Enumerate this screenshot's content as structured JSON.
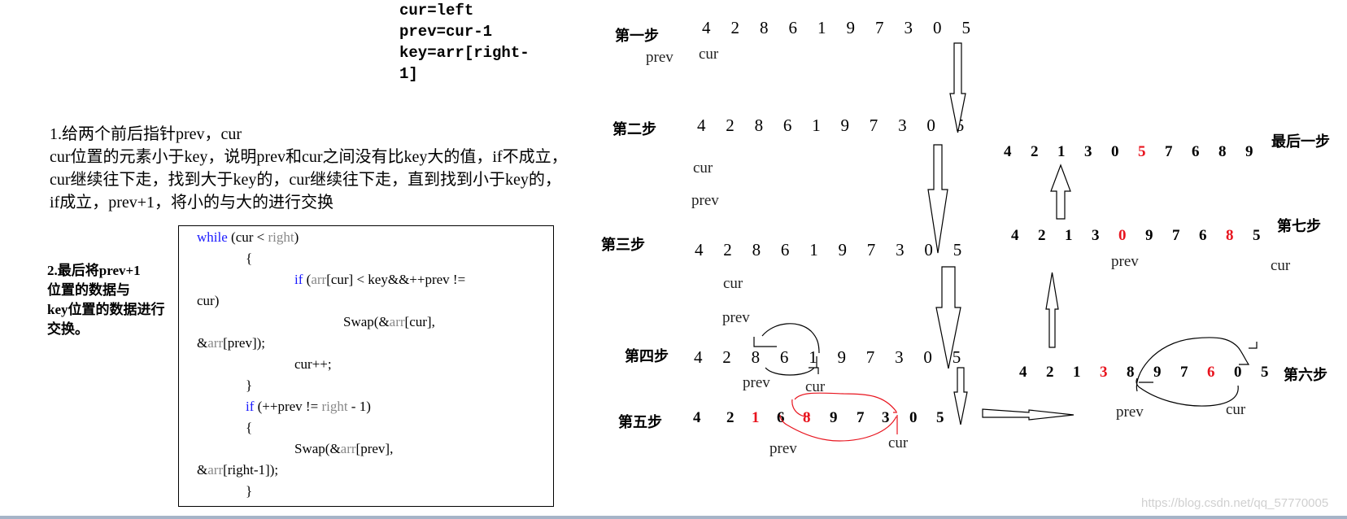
{
  "init_vars": [
    "cur=left",
    "prev=cur-1",
    "key=arr[right-",
    "1]"
  ],
  "explanation": {
    "line1": "1.给两个前后指针prev，cur",
    "body": "cur位置的元素小于key，说明prev和cur之间没有比key大的值，if不成立，cur继续往下走，找到大于key的，cur继续往下走，直到找到小于key的，if成立，prev+1，将小的与大的进行交换"
  },
  "note2": [
    "2.最后将prev+1",
    "位置的数据与",
    "key位置的数据进行",
    "交换。"
  ],
  "code": {
    "lines": [
      {
        "indent": 0,
        "parts": [
          {
            "t": "while",
            "c": "kw"
          },
          {
            "t": " (cur < "
          },
          {
            "t": "right",
            "c": "gr"
          },
          {
            "t": ")"
          }
        ]
      },
      {
        "indent": 1,
        "parts": [
          {
            "t": "{"
          }
        ]
      },
      {
        "indent": 2,
        "parts": [
          {
            "t": "if",
            "c": "kw"
          },
          {
            "t": " ("
          },
          {
            "t": "arr",
            "c": "gr"
          },
          {
            "t": "[cur] < key&&++prev !="
          }
        ]
      },
      {
        "indent": 0,
        "parts": [
          {
            "t": "cur)"
          }
        ]
      },
      {
        "indent": 3,
        "parts": [
          {
            "t": "Swap(&"
          },
          {
            "t": "arr",
            "c": "gr"
          },
          {
            "t": "[cur],"
          }
        ]
      },
      {
        "indent": 0,
        "parts": [
          {
            "t": "&"
          },
          {
            "t": "arr",
            "c": "gr"
          },
          {
            "t": "[prev]);"
          }
        ]
      },
      {
        "indent": 2,
        "parts": [
          {
            "t": "cur++;"
          }
        ]
      },
      {
        "indent": 1,
        "parts": [
          {
            "t": "}"
          }
        ]
      },
      {
        "indent": 1,
        "parts": [
          {
            "t": "if",
            "c": "kw"
          },
          {
            "t": " (++prev != "
          },
          {
            "t": "right",
            "c": "gr"
          },
          {
            "t": " - 1)"
          }
        ]
      },
      {
        "indent": 1,
        "parts": [
          {
            "t": "{"
          }
        ]
      },
      {
        "indent": 2,
        "parts": [
          {
            "t": "Swap(&"
          },
          {
            "t": "arr",
            "c": "gr"
          },
          {
            "t": "[prev],"
          }
        ]
      },
      {
        "indent": 0,
        "parts": [
          {
            "t": "&"
          },
          {
            "t": "arr",
            "c": "gr"
          },
          {
            "t": "[right-1]);"
          }
        ]
      },
      {
        "indent": 1,
        "parts": [
          {
            "t": "}"
          }
        ]
      }
    ]
  },
  "steps": [
    {
      "id": "step1",
      "label": "第一步",
      "values": [
        4,
        2,
        8,
        6,
        1,
        9,
        7,
        3,
        0,
        5
      ],
      "red": [],
      "bold": false,
      "pointers": [
        {
          "name": "prev",
          "index": -1
        },
        {
          "name": "cur",
          "index": 0
        }
      ]
    },
    {
      "id": "step2",
      "label": "第二步",
      "values": [
        4,
        2,
        8,
        6,
        1,
        9,
        7,
        3,
        0,
        5
      ],
      "red": [],
      "bold": false,
      "pointers": [
        {
          "name": "cur",
          "index": 0
        },
        {
          "name": "prev",
          "index": 0
        }
      ]
    },
    {
      "id": "step3",
      "label": "第三步",
      "values": [
        4,
        2,
        8,
        6,
        1,
        9,
        7,
        3,
        0,
        5
      ],
      "red": [],
      "bold": false,
      "pointers": [
        {
          "name": "cur",
          "index": 1
        },
        {
          "name": "prev",
          "index": 1
        }
      ]
    },
    {
      "id": "step4",
      "label": "第四步",
      "values": [
        4,
        2,
        8,
        6,
        1,
        9,
        7,
        3,
        0,
        5
      ],
      "red": [],
      "bold": false,
      "pointers": [
        {
          "name": "prev",
          "index": 2
        },
        {
          "name": "cur",
          "index": 4
        }
      ]
    },
    {
      "id": "step5",
      "label": "第五步",
      "values": [
        4,
        2,
        1,
        6,
        8,
        9,
        7,
        3,
        0,
        5
      ],
      "red": [
        2,
        4
      ],
      "bold": true,
      "pointers": [
        {
          "name": "prev",
          "index": 3
        },
        {
          "name": "cur",
          "index": 7
        }
      ]
    },
    {
      "id": "step6",
      "label": "第六步",
      "values": [
        4,
        2,
        1,
        3,
        8,
        9,
        7,
        6,
        0,
        5
      ],
      "red": [
        3,
        7
      ],
      "bold": true,
      "pointers": [
        {
          "name": "prev",
          "index": 4
        },
        {
          "name": "cur",
          "index": 8
        }
      ]
    },
    {
      "id": "step7",
      "label": "第七步",
      "values": [
        4,
        2,
        1,
        3,
        0,
        9,
        7,
        6,
        8,
        5
      ],
      "red": [
        4,
        8
      ],
      "bold": true,
      "pointers": [
        {
          "name": "prev",
          "index": 4
        },
        {
          "name": "cur",
          "index": 9
        }
      ]
    },
    {
      "id": "final",
      "label": "最后一步",
      "values": [
        4,
        2,
        1,
        3,
        0,
        5,
        7,
        6,
        8,
        9
      ],
      "red": [
        5
      ],
      "bold": true,
      "pointers": []
    }
  ],
  "watermark": "https://blog.csdn.net/qq_57770005",
  "colors": {
    "highlight": "#e8141e",
    "keyword": "#1a1aff",
    "muted": "#888888",
    "swap_arc_step5": "#e8141e"
  }
}
